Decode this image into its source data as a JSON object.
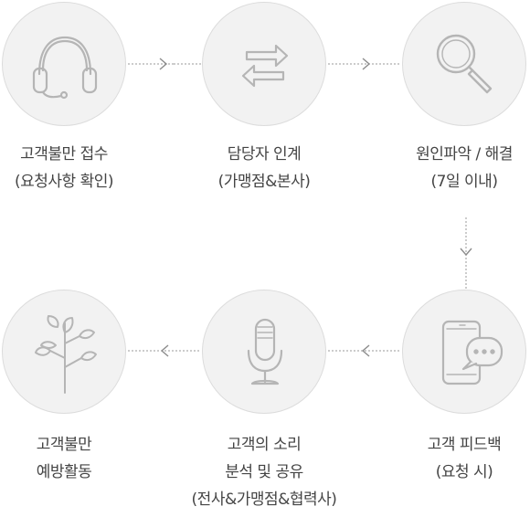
{
  "steps": [
    {
      "id": "step1",
      "icon": "headset-icon",
      "title": "고객불만 접수",
      "sub": "(요청사항 확인)"
    },
    {
      "id": "step2",
      "icon": "exchange-arrows-icon",
      "title": "담당자 인계",
      "sub": "(가맹점&본사)"
    },
    {
      "id": "step3",
      "icon": "magnifier-icon",
      "title": "원인파악 / 해결",
      "sub": "(7일 이내)"
    },
    {
      "id": "step4",
      "icon": "smartphone-chat-icon",
      "title": "고객 피드백",
      "sub": "(요청 시)"
    },
    {
      "id": "step5",
      "icon": "microphone-icon",
      "title": "고객의 소리",
      "sub": "분석 및 공유",
      "sub2": "(전사&가맹점&협력사)"
    },
    {
      "id": "step6",
      "icon": "sapling-icon",
      "title": "고객불만",
      "sub": "예방활동"
    }
  ],
  "colors": {
    "circle_fill": "#f2f2f2",
    "circle_border": "#dcdcdc",
    "icon_stroke": "#b5b5b5",
    "text": "#444444",
    "connector": "#9a9a9a"
  }
}
